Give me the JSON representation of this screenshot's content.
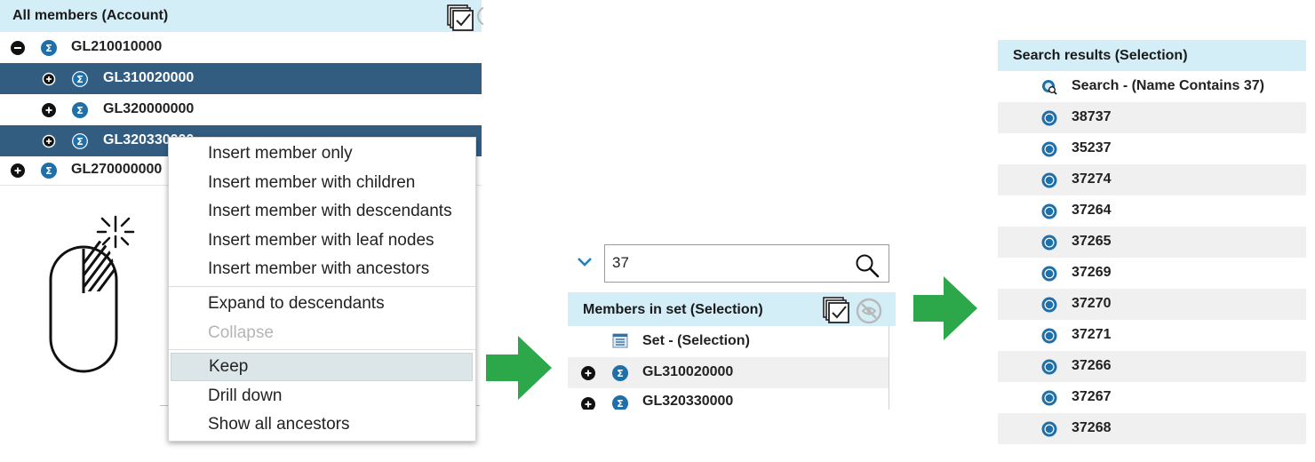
{
  "tree": {
    "header": "All members (Account)",
    "rows": [
      {
        "label": "GL210010000",
        "expander": "minus",
        "selected": false
      },
      {
        "label": "GL310020000",
        "expander": "plus",
        "selected": true
      },
      {
        "label": "GL320000000",
        "expander": "plus",
        "selected": false
      },
      {
        "label": "GL320330000",
        "expander": "plus",
        "selected": true
      },
      {
        "label": "GL270000000",
        "expander": "plus",
        "selected": false
      }
    ]
  },
  "context_menu": {
    "items": [
      "Insert member only",
      "Insert member with children",
      "Insert member with descendants",
      "Insert member with leaf nodes",
      "Insert member with ancestors",
      "Expand to descendants",
      "Collapse",
      "Keep",
      "Drill down",
      "Show all ancestors"
    ],
    "disabled_item": "Collapse",
    "highlighted_item": "Keep"
  },
  "search": {
    "value": "37"
  },
  "members_in_set": {
    "header": "Members in set (Selection)",
    "set_label": "Set - (Selection)",
    "rows": [
      "GL310020000",
      "GL320330000"
    ]
  },
  "search_results": {
    "header": "Search results (Selection)",
    "query_label": "Search - (Name Contains 37)",
    "items": [
      "38737",
      "35237",
      "37274",
      "37264",
      "37265",
      "37269",
      "37270",
      "37271",
      "37266",
      "37267",
      "37268"
    ]
  },
  "colors": {
    "header_bg": "#d3eef7",
    "selected_row": "#325d80",
    "sigma_blue": "#1f6fa8",
    "arrow_green": "#2ca84a",
    "alt_row": "#f0f0f0"
  }
}
